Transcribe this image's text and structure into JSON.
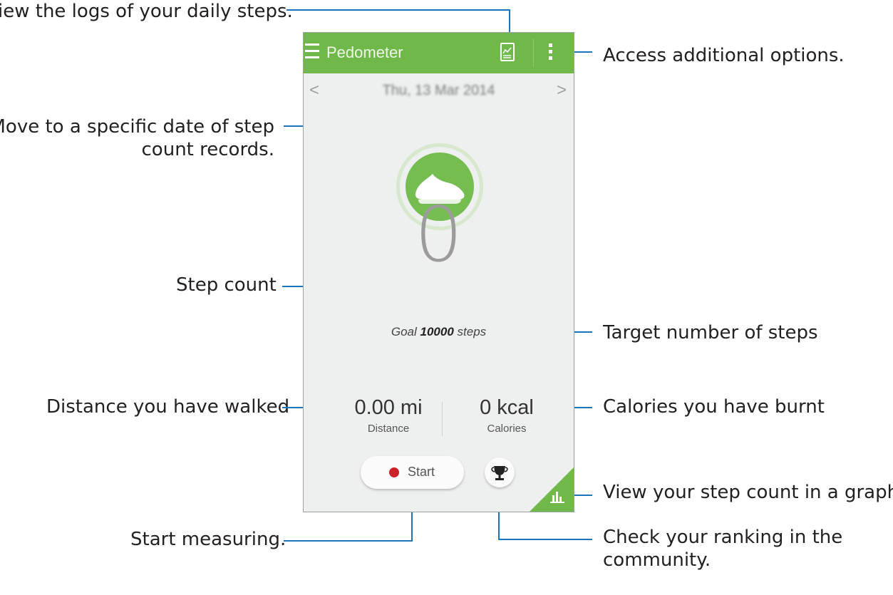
{
  "app": {
    "title": "Pedometer",
    "date": "Thu, 13 Mar 2014",
    "prev_arrow": "<",
    "next_arrow": ">",
    "step_count": "0",
    "goal_prefix": "Goal",
    "goal_value": "10000",
    "goal_suffix": "steps",
    "distance_value": "0.00 mi",
    "distance_label": "Distance",
    "calories_value": "0 kcal",
    "calories_label": "Calories",
    "start_label": "Start"
  },
  "annotations": {
    "logs": "iew the logs of your daily steps.",
    "options": "Access additional options.",
    "date_line1": "Move to a specific date of step",
    "date_line2": "count records.",
    "step_count": "Step count",
    "target": "Target number of steps",
    "distance": "Distance you have walked",
    "calories": "Calories you have burnt",
    "graph": "View your step count in a graph.",
    "start": "Start measuring.",
    "ranking_line1": "Check your ranking in the",
    "ranking_line2": "community."
  },
  "colors": {
    "accent_green": "#70b84a",
    "callout_blue": "#1b75bb",
    "record_red": "#cc2229"
  },
  "icons": [
    "menu-icon",
    "log-icon",
    "more-options-icon",
    "shoe-icon",
    "record-icon",
    "trophy-icon",
    "bar-graph-icon"
  ]
}
